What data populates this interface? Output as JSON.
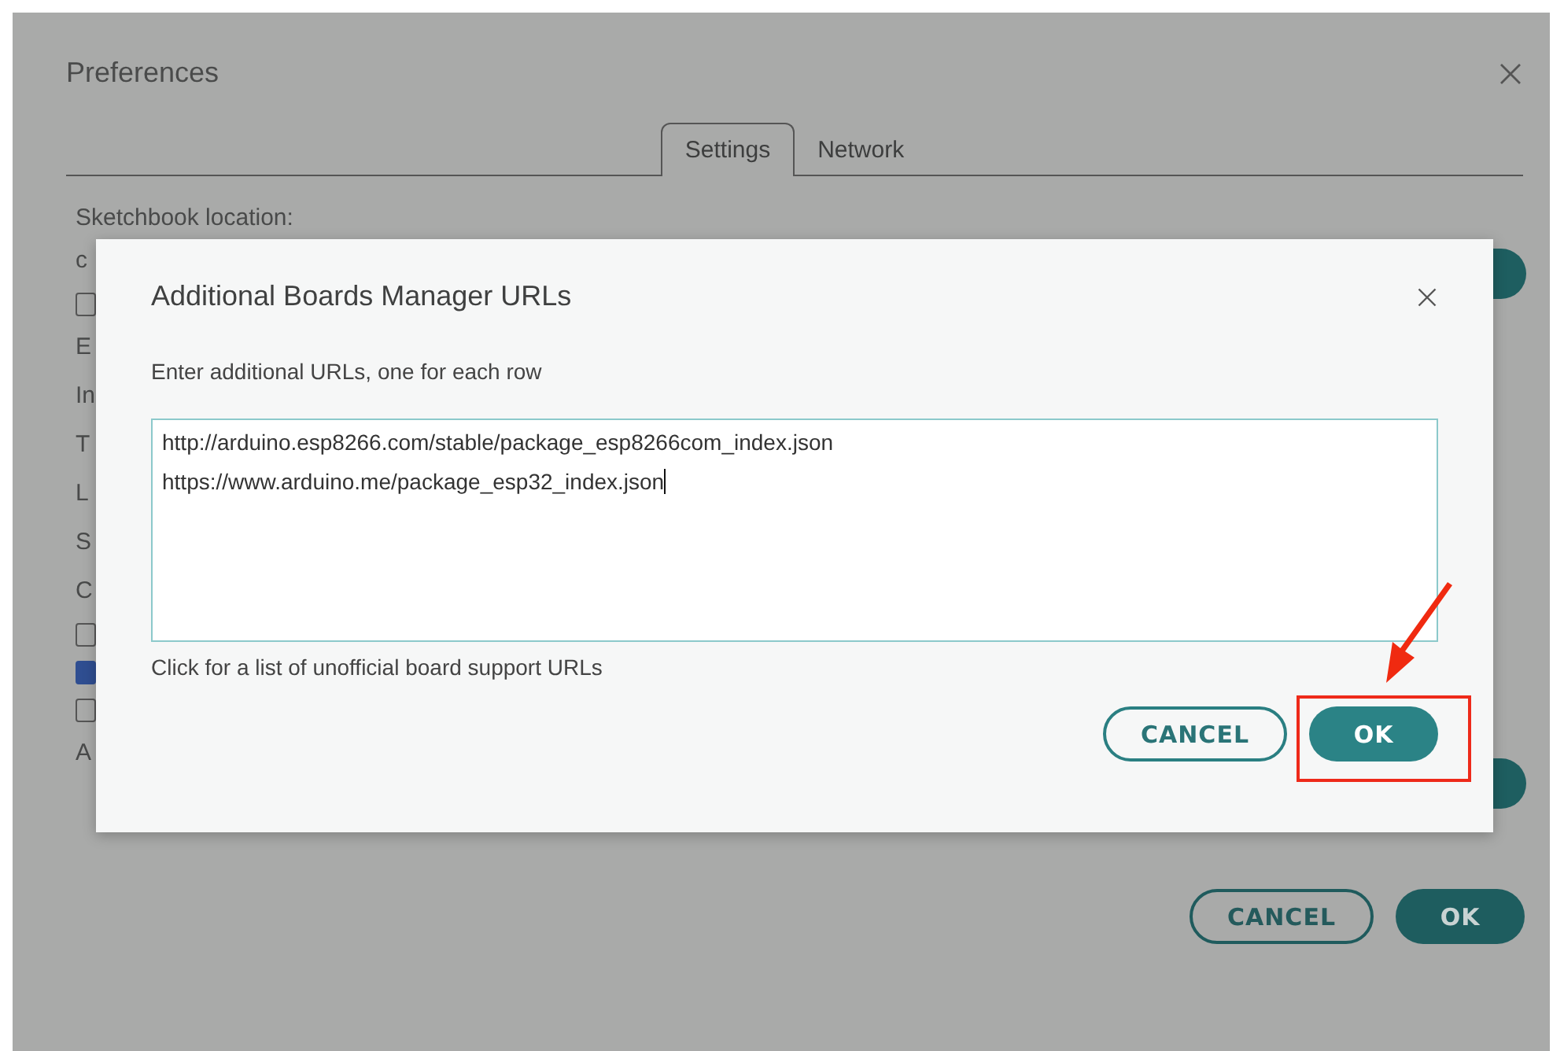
{
  "window": {
    "title": "Preferences"
  },
  "tabs": [
    {
      "label": "Settings",
      "selected": true
    },
    {
      "label": "Network",
      "selected": false
    }
  ],
  "settings": {
    "sketchbook_label": "Sketchbook location:",
    "rows": [
      {
        "kind": "text",
        "text": "c"
      },
      {
        "kind": "checkbox",
        "checked": false
      },
      {
        "kind": "text",
        "text": "E"
      },
      {
        "kind": "text",
        "text": "In"
      },
      {
        "kind": "text",
        "text": "T"
      },
      {
        "kind": "text",
        "text": "L"
      },
      {
        "kind": "text",
        "text": "S"
      },
      {
        "kind": "text",
        "text": "C"
      },
      {
        "kind": "checkbox",
        "checked": false
      },
      {
        "kind": "checkbox",
        "checked": true
      },
      {
        "kind": "checkbox",
        "checked": false
      },
      {
        "kind": "text",
        "text": "A"
      }
    ]
  },
  "buttons": [
    "CANCEL",
    "OK"
  ],
  "dialog": {
    "title": "Additional Boards Manager URLs",
    "instruction": "Enter additional URLs, one for each row",
    "urls": [
      "http://arduino.esp8266.com/stable/package_esp8266com_index.json",
      "https://www.arduino.me/package_esp32_index.json"
    ],
    "link": "Click for a list of unofficial board support URLs",
    "buttons": [
      "CANCEL",
      "OK"
    ]
  }
}
